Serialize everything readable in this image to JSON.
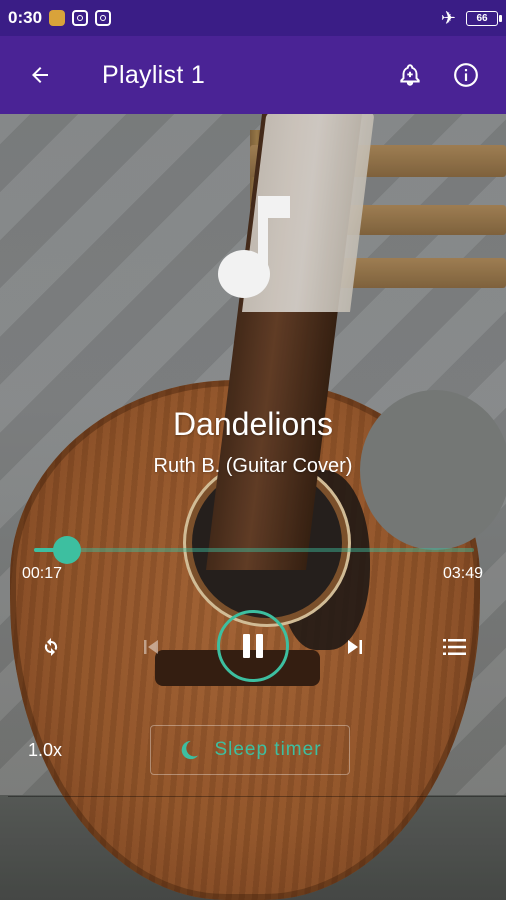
{
  "status_bar": {
    "time": "0:30",
    "battery": "66",
    "icons": [
      "notification-app-icon",
      "instagram-icon",
      "instagram-icon",
      "airplane-icon",
      "battery-icon"
    ]
  },
  "app_bar": {
    "title": "Playlist 1",
    "back_icon": "arrow-back-icon",
    "alarm_icon": "alarm-add-icon",
    "info_icon": "info-icon",
    "color": "#4a2395"
  },
  "track": {
    "title": "Dandelions",
    "artist": "Ruth B. (Guitar Cover)",
    "art_icon": "music-note-icon"
  },
  "progress": {
    "current": "00:17",
    "total": "03:49",
    "fraction": 0.074,
    "accent": "#3dbfa0"
  },
  "controls": {
    "repeat_icon": "repeat-icon",
    "previous_icon": "skip-previous-icon",
    "play_state": "playing",
    "pause_icon": "pause-icon",
    "next_icon": "skip-next-icon",
    "queue_icon": "playlist-icon"
  },
  "extras": {
    "speed": "1.0x",
    "sleep_timer_label": "Sleep timer",
    "sleep_icon": "moon-icon"
  }
}
